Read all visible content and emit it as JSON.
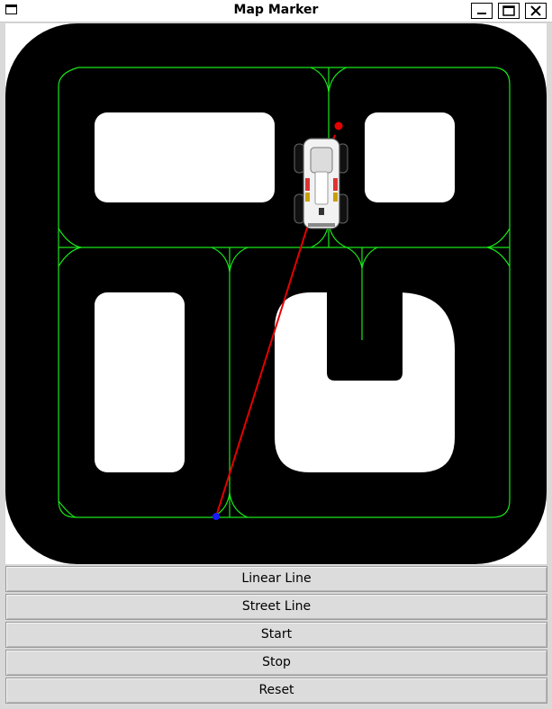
{
  "window": {
    "title": "Map Marker"
  },
  "map": {
    "track_color": "#000000",
    "background_color": "#ffffff",
    "path_color": "#19e619",
    "marker_line_color": "#e60000",
    "start_marker_color": "#1a1aff",
    "target_marker_color": "#e60000",
    "vehicle": "car-top-view"
  },
  "buttons": [
    {
      "id": "linear-line",
      "label": "Linear Line"
    },
    {
      "id": "street-line",
      "label": "Street Line"
    },
    {
      "id": "start",
      "label": "Start"
    },
    {
      "id": "stop",
      "label": "Stop"
    },
    {
      "id": "reset",
      "label": "Reset"
    }
  ]
}
